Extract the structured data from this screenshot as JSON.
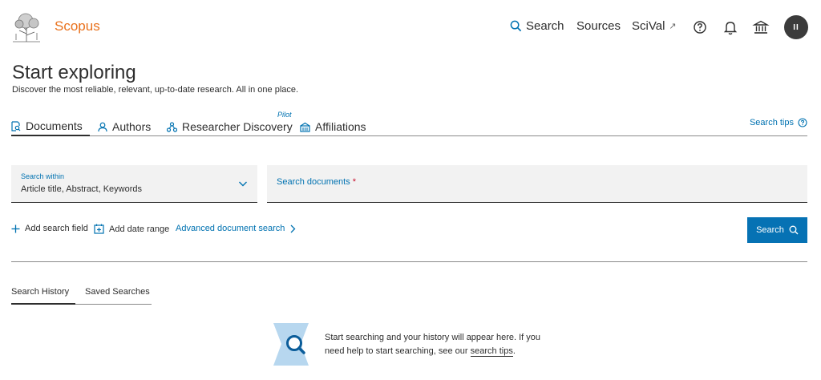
{
  "header": {
    "brand": "Scopus",
    "nav": {
      "search": "Search",
      "sources": "Sources",
      "scival": "SciVal",
      "scival_ext": "↗"
    },
    "avatar_initials": "II",
    "icons": [
      "search-icon",
      "help-icon",
      "bell-icon",
      "institution-icon"
    ]
  },
  "page": {
    "title": "Start exploring",
    "subtitle": "Discover the most reliable, relevant, up-to-date research. All in one place."
  },
  "tabs": {
    "documents": "Documents",
    "authors": "Authors",
    "researcher": "Researcher Discovery",
    "pilot_badge": "Pilot",
    "affiliations": "Affiliations",
    "search_tips": "Search tips"
  },
  "search_form": {
    "within_label": "Search within",
    "within_value": "Article title, Abstract, Keywords",
    "docs_label": "Search documents",
    "docs_required": "*",
    "docs_value": ""
  },
  "actions": {
    "add_field": "Add search field",
    "add_date": "Add date range",
    "advanced": "Advanced document search",
    "search_button": "Search"
  },
  "history": {
    "tab_history": "Search History",
    "tab_saved": "Saved Searches",
    "empty_text": "Start searching and your history will appear here. If you need help to start searching, see our",
    "empty_link": "search tips",
    "empty_end": "."
  },
  "colors": {
    "brand_orange": "#e9711c",
    "link_blue": "#0072b1",
    "button_blue": "#0672b4",
    "field_bg": "#f2f2f2"
  }
}
